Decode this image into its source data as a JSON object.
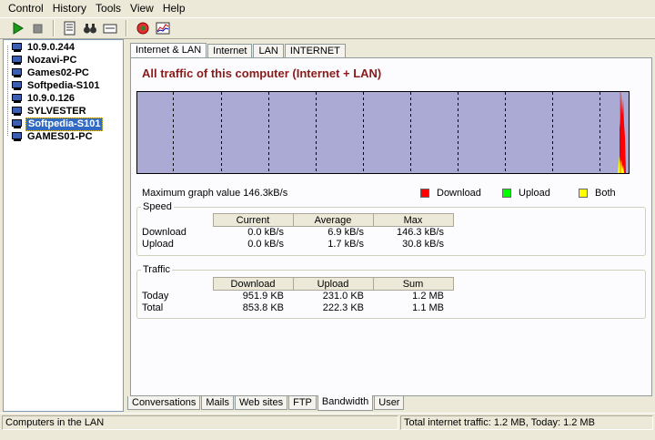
{
  "menu": [
    "Control",
    "History",
    "Tools",
    "View",
    "Help"
  ],
  "toolbar": {
    "icons": [
      "play-icon",
      "stop-icon",
      "report-icon",
      "binoculars-icon",
      "message-icon",
      "network-alert-icon",
      "graph-icon"
    ]
  },
  "tree": {
    "items": [
      {
        "label": "10.9.0.244",
        "selected": false
      },
      {
        "label": "Nozavi-PC",
        "selected": false
      },
      {
        "label": "Games02-PC",
        "selected": false
      },
      {
        "label": "Softpedia-S101",
        "selected": false
      },
      {
        "label": "10.9.0.126",
        "selected": false
      },
      {
        "label": "SYLVESTER",
        "selected": false
      },
      {
        "label": "Softpedia-S101",
        "selected": true
      },
      {
        "label": "GAMES01-PC",
        "selected": false
      }
    ]
  },
  "tabs_top": [
    {
      "label": "Internet & LAN",
      "active": true
    },
    {
      "label": "Internet",
      "active": false
    },
    {
      "label": "LAN",
      "active": false
    },
    {
      "label": "INTERNET",
      "active": false
    }
  ],
  "graph": {
    "title": "All traffic of this computer (Internet + LAN)",
    "background": "#aaaad4",
    "max_label": "Maximum graph value",
    "max_value": "146.3kB/s"
  },
  "legend": [
    {
      "label": "Download",
      "color": "#ff0000"
    },
    {
      "label": "Upload",
      "color": "#00ff00"
    },
    {
      "label": "Both",
      "color": "#ffff00"
    }
  ],
  "speed": {
    "legend": "Speed",
    "headers": [
      "",
      "Current",
      "Average",
      "Max"
    ],
    "rows": [
      [
        "Download",
        "0.0 kB/s",
        "6.9 kB/s",
        "146.3 kB/s"
      ],
      [
        "Upload",
        "0.0 kB/s",
        "1.7 kB/s",
        "30.8 kB/s"
      ]
    ]
  },
  "traffic": {
    "legend": "Traffic",
    "headers": [
      "",
      "Download",
      "Upload",
      "Sum"
    ],
    "rows": [
      [
        "Today",
        "951.9 KB",
        "231.0 KB",
        "1.2 MB"
      ],
      [
        "Total",
        "853.8 KB",
        "222.3 KB",
        "1.1 MB"
      ]
    ]
  },
  "tabs_bottom": [
    {
      "label": "Conversations",
      "active": false
    },
    {
      "label": "Mails",
      "active": false
    },
    {
      "label": "Web sites",
      "active": false
    },
    {
      "label": "FTP",
      "active": false
    },
    {
      "label": "Bandwidth",
      "active": true
    },
    {
      "label": "User",
      "active": false
    }
  ],
  "status": {
    "left": "Computers in the LAN",
    "right": "Total internet traffic: 1.2 MB, Today: 1.2 MB"
  }
}
